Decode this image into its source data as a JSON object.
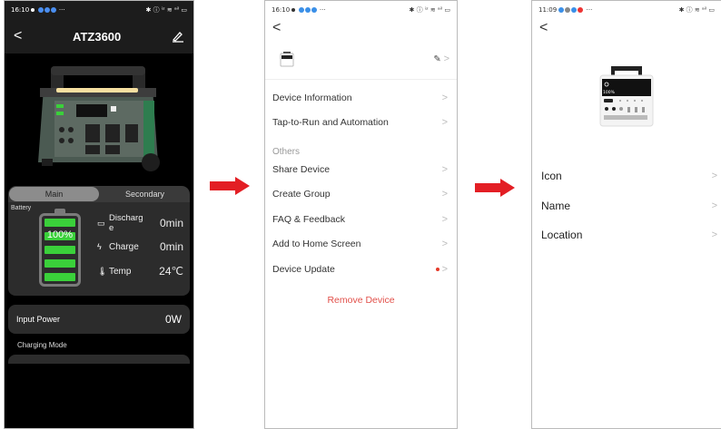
{
  "screens": {
    "main": {
      "status_time": "16:10",
      "status_right": "✱ ⓘ ⁱᶻ ≋ ᵃⁱˡ ▭",
      "title": "ATZ3600",
      "tabs": [
        "Main",
        "Secondary"
      ],
      "battery_label": "Battery",
      "battery_percent": "100%",
      "stats": [
        {
          "label": "Discharge",
          "value": "0min"
        },
        {
          "label": "Charge",
          "value": "0min"
        },
        {
          "label": "Temp",
          "value": "24℃"
        }
      ],
      "input_power_label": "Input Power",
      "input_power_value": "0W",
      "charging_mode_label": "Charging Mode"
    },
    "settings": {
      "status_time": "16:10",
      "status_right": "✱ ⓘ ⁱᶻ ≋ ᵃⁱˡ ▭",
      "menu": [
        "Device Information",
        "Tap-to-Run and Automation"
      ],
      "others_label": "Others",
      "others": [
        "Share Device",
        "Create Group",
        "FAQ & Feedback",
        "Add to Home Screen",
        "Device Update"
      ],
      "remove_label": "Remove Device"
    },
    "edit": {
      "status_time": "11:09",
      "status_right": "✱ ⓘ ≋ ᵃⁱˡ ▭",
      "screen_text": "100%",
      "items": [
        "Icon",
        "Name",
        "Location"
      ]
    }
  },
  "colors": {
    "arrow": "#e31e24",
    "battery_green": "#3ad03a",
    "remove_red": "#e2504a"
  }
}
